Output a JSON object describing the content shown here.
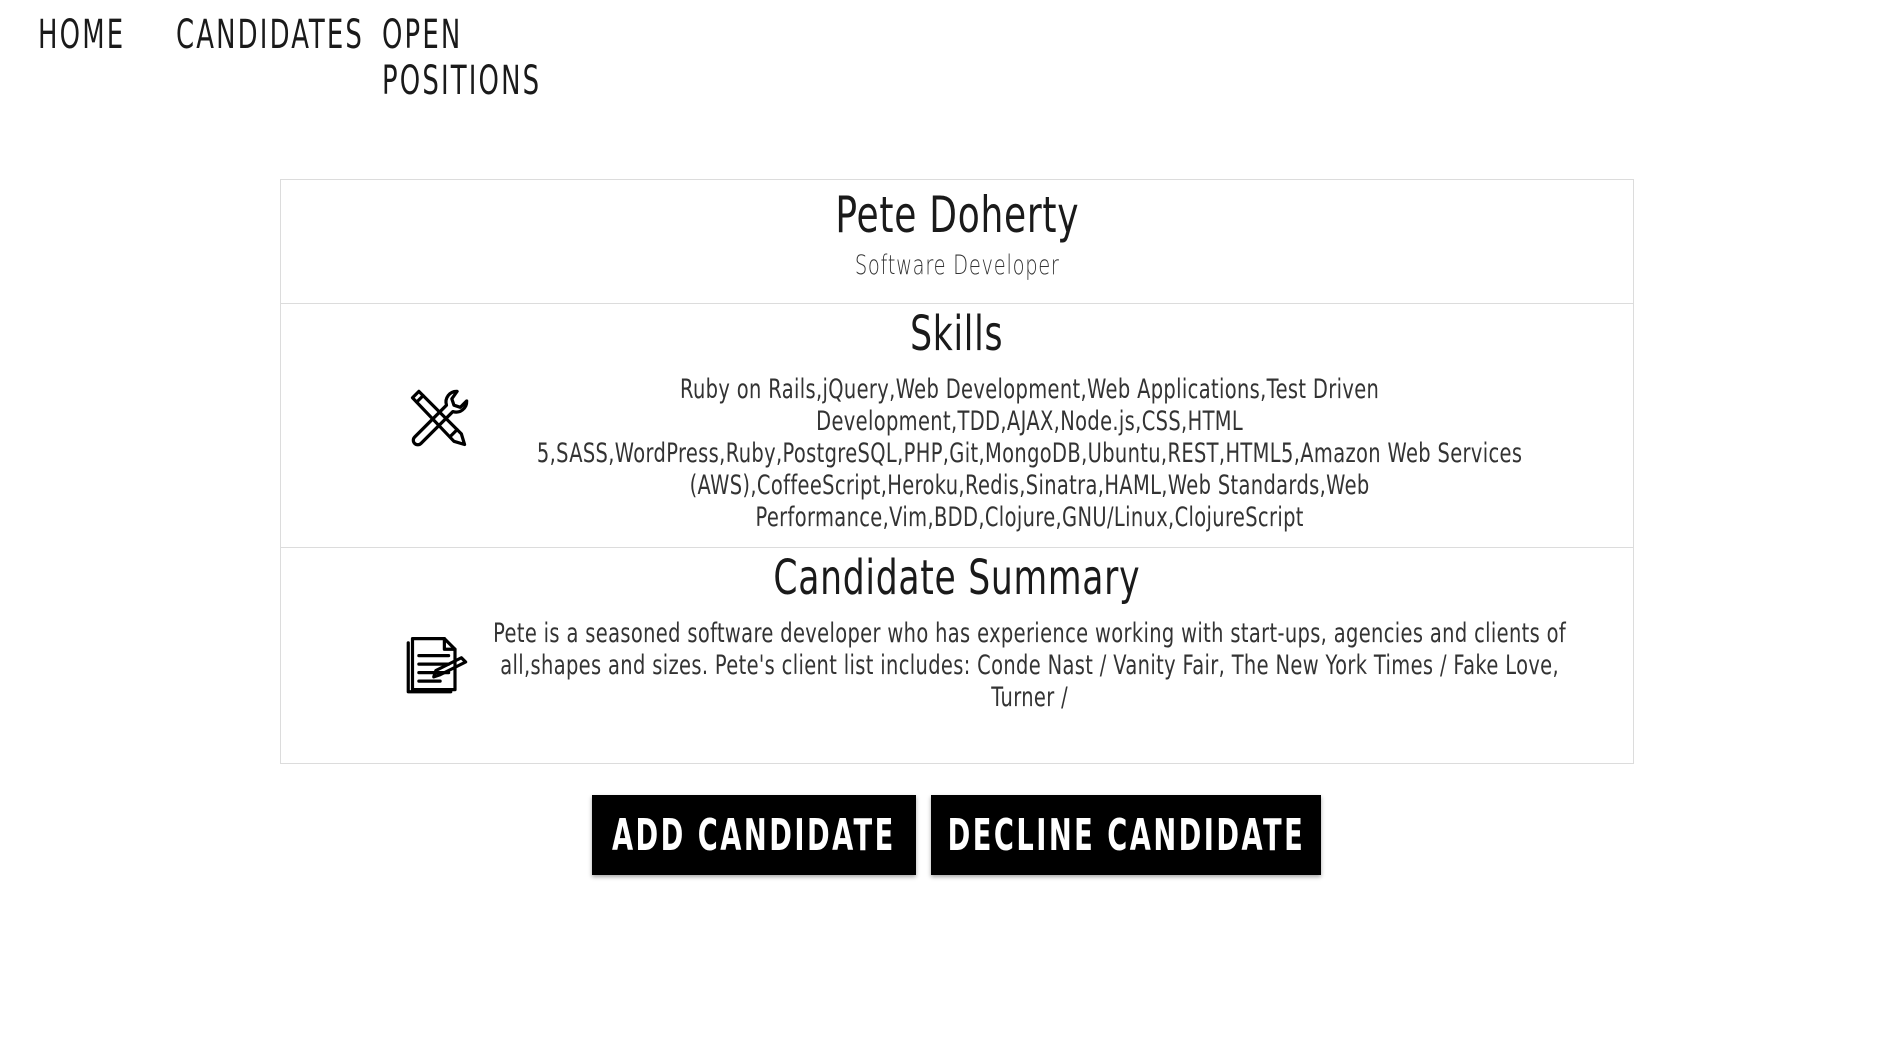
{
  "nav": {
    "home": "HOME",
    "candidates": "CANDIDATES",
    "open_positions": "OPEN POSITIONS"
  },
  "candidate": {
    "name": "Pete Doherty",
    "title": "Software Developer"
  },
  "skills": {
    "heading": "Skills",
    "icon": "tools-icon",
    "text": "Ruby on Rails,jQuery,Web Development,Web Applications,Test Driven Development,TDD,AJAX,Node.js,CSS,HTML 5,SASS,WordPress,Ruby,PostgreSQL,PHP,Git,MongoDB,Ubuntu,REST,HTML5,Amazon Web Services (AWS),CoffeeScript,Heroku,Redis,Sinatra,HAML,Web Standards,Web Performance,Vim,BDD,Clojure,GNU/Linux,ClojureScript"
  },
  "summary": {
    "heading": "Candidate Summary",
    "icon": "document-icon",
    "text": "Pete is a seasoned software developer who has experience working with start-ups, agencies and clients of all,shapes and sizes. Pete's client list includes: Conde Nast / Vanity Fair, The New York Times / Fake Love, Turner /"
  },
  "actions": {
    "add": "ADD CANDIDATE",
    "decline": "DECLINE CANDIDATE"
  },
  "colors": {
    "button_bg": "#000000",
    "button_text": "#ffffff",
    "border": "#dcdcdc"
  }
}
